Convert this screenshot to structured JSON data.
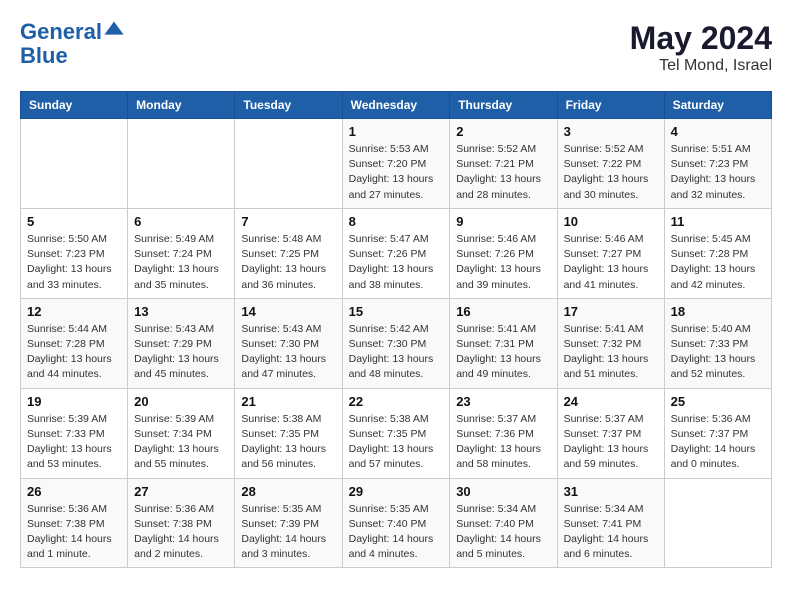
{
  "header": {
    "logo_line1": "General",
    "logo_line2": "Blue",
    "month_year": "May 2024",
    "location": "Tel Mond, Israel"
  },
  "weekdays": [
    "Sunday",
    "Monday",
    "Tuesday",
    "Wednesday",
    "Thursday",
    "Friday",
    "Saturday"
  ],
  "weeks": [
    [
      {
        "day": "",
        "info": ""
      },
      {
        "day": "",
        "info": ""
      },
      {
        "day": "",
        "info": ""
      },
      {
        "day": "1",
        "info": "Sunrise: 5:53 AM\nSunset: 7:20 PM\nDaylight: 13 hours\nand 27 minutes."
      },
      {
        "day": "2",
        "info": "Sunrise: 5:52 AM\nSunset: 7:21 PM\nDaylight: 13 hours\nand 28 minutes."
      },
      {
        "day": "3",
        "info": "Sunrise: 5:52 AM\nSunset: 7:22 PM\nDaylight: 13 hours\nand 30 minutes."
      },
      {
        "day": "4",
        "info": "Sunrise: 5:51 AM\nSunset: 7:23 PM\nDaylight: 13 hours\nand 32 minutes."
      }
    ],
    [
      {
        "day": "5",
        "info": "Sunrise: 5:50 AM\nSunset: 7:23 PM\nDaylight: 13 hours\nand 33 minutes."
      },
      {
        "day": "6",
        "info": "Sunrise: 5:49 AM\nSunset: 7:24 PM\nDaylight: 13 hours\nand 35 minutes."
      },
      {
        "day": "7",
        "info": "Sunrise: 5:48 AM\nSunset: 7:25 PM\nDaylight: 13 hours\nand 36 minutes."
      },
      {
        "day": "8",
        "info": "Sunrise: 5:47 AM\nSunset: 7:26 PM\nDaylight: 13 hours\nand 38 minutes."
      },
      {
        "day": "9",
        "info": "Sunrise: 5:46 AM\nSunset: 7:26 PM\nDaylight: 13 hours\nand 39 minutes."
      },
      {
        "day": "10",
        "info": "Sunrise: 5:46 AM\nSunset: 7:27 PM\nDaylight: 13 hours\nand 41 minutes."
      },
      {
        "day": "11",
        "info": "Sunrise: 5:45 AM\nSunset: 7:28 PM\nDaylight: 13 hours\nand 42 minutes."
      }
    ],
    [
      {
        "day": "12",
        "info": "Sunrise: 5:44 AM\nSunset: 7:28 PM\nDaylight: 13 hours\nand 44 minutes."
      },
      {
        "day": "13",
        "info": "Sunrise: 5:43 AM\nSunset: 7:29 PM\nDaylight: 13 hours\nand 45 minutes."
      },
      {
        "day": "14",
        "info": "Sunrise: 5:43 AM\nSunset: 7:30 PM\nDaylight: 13 hours\nand 47 minutes."
      },
      {
        "day": "15",
        "info": "Sunrise: 5:42 AM\nSunset: 7:30 PM\nDaylight: 13 hours\nand 48 minutes."
      },
      {
        "day": "16",
        "info": "Sunrise: 5:41 AM\nSunset: 7:31 PM\nDaylight: 13 hours\nand 49 minutes."
      },
      {
        "day": "17",
        "info": "Sunrise: 5:41 AM\nSunset: 7:32 PM\nDaylight: 13 hours\nand 51 minutes."
      },
      {
        "day": "18",
        "info": "Sunrise: 5:40 AM\nSunset: 7:33 PM\nDaylight: 13 hours\nand 52 minutes."
      }
    ],
    [
      {
        "day": "19",
        "info": "Sunrise: 5:39 AM\nSunset: 7:33 PM\nDaylight: 13 hours\nand 53 minutes."
      },
      {
        "day": "20",
        "info": "Sunrise: 5:39 AM\nSunset: 7:34 PM\nDaylight: 13 hours\nand 55 minutes."
      },
      {
        "day": "21",
        "info": "Sunrise: 5:38 AM\nSunset: 7:35 PM\nDaylight: 13 hours\nand 56 minutes."
      },
      {
        "day": "22",
        "info": "Sunrise: 5:38 AM\nSunset: 7:35 PM\nDaylight: 13 hours\nand 57 minutes."
      },
      {
        "day": "23",
        "info": "Sunrise: 5:37 AM\nSunset: 7:36 PM\nDaylight: 13 hours\nand 58 minutes."
      },
      {
        "day": "24",
        "info": "Sunrise: 5:37 AM\nSunset: 7:37 PM\nDaylight: 13 hours\nand 59 minutes."
      },
      {
        "day": "25",
        "info": "Sunrise: 5:36 AM\nSunset: 7:37 PM\nDaylight: 14 hours\nand 0 minutes."
      }
    ],
    [
      {
        "day": "26",
        "info": "Sunrise: 5:36 AM\nSunset: 7:38 PM\nDaylight: 14 hours\nand 1 minute."
      },
      {
        "day": "27",
        "info": "Sunrise: 5:36 AM\nSunset: 7:38 PM\nDaylight: 14 hours\nand 2 minutes."
      },
      {
        "day": "28",
        "info": "Sunrise: 5:35 AM\nSunset: 7:39 PM\nDaylight: 14 hours\nand 3 minutes."
      },
      {
        "day": "29",
        "info": "Sunrise: 5:35 AM\nSunset: 7:40 PM\nDaylight: 14 hours\nand 4 minutes."
      },
      {
        "day": "30",
        "info": "Sunrise: 5:34 AM\nSunset: 7:40 PM\nDaylight: 14 hours\nand 5 minutes."
      },
      {
        "day": "31",
        "info": "Sunrise: 5:34 AM\nSunset: 7:41 PM\nDaylight: 14 hours\nand 6 minutes."
      },
      {
        "day": "",
        "info": ""
      }
    ]
  ]
}
